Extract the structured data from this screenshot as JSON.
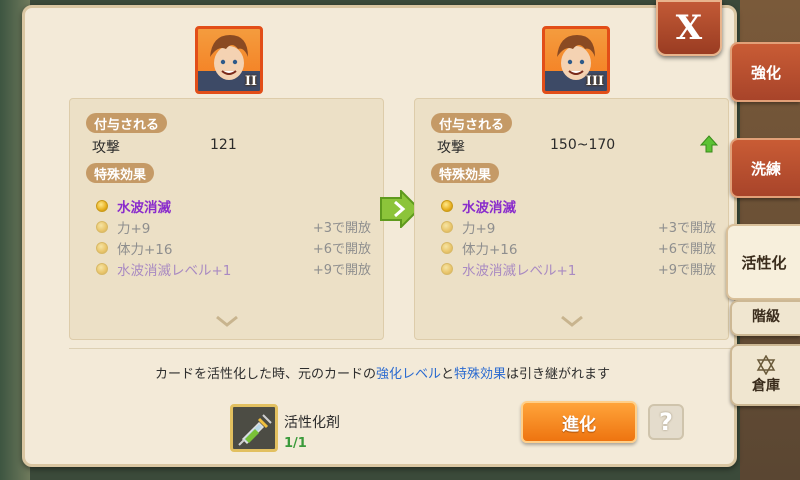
{
  "close_label": "X",
  "tabs": {
    "enhance": "強化",
    "refine": "洗練",
    "activate": "活性化",
    "rank": "階級",
    "storage": "倉庫"
  },
  "left_card": {
    "rank": "II",
    "granted_label": "付与される",
    "stat_label": "攻撃",
    "stat_value": "121",
    "special_label": "特殊効果",
    "effects": [
      {
        "name": "水波消滅",
        "condition": ""
      },
      {
        "name": "力+9",
        "condition": "+3で開放"
      },
      {
        "name": "体力+16",
        "condition": "+6で開放"
      },
      {
        "name": "水波消滅レベル+1",
        "condition": "+9で開放"
      }
    ]
  },
  "right_card": {
    "rank": "III",
    "granted_label": "付与される",
    "stat_label": "攻撃",
    "stat_value": "150~170",
    "special_label": "特殊効果",
    "effects": [
      {
        "name": "水波消滅",
        "condition": ""
      },
      {
        "name": "力+9",
        "condition": "+3で開放"
      },
      {
        "name": "体力+16",
        "condition": "+6で開放"
      },
      {
        "name": "水波消滅レベル+1",
        "condition": "+9で開放"
      }
    ]
  },
  "notice": {
    "prefix": "カードを活性化した時、元のカードの",
    "highlight1": "強化レベル",
    "mid": "と",
    "highlight2": "特殊効果",
    "suffix": "は引き継がれます"
  },
  "item": {
    "name": "活性化剤",
    "count": "1/1"
  },
  "evolve_label": "進化",
  "help_label": "?",
  "colors": {
    "accent_orange": "#ee7410",
    "tab_red": "#a8442a",
    "effect_purple": "#8a2ccc",
    "highlight_blue": "#2a6ad0",
    "count_green": "#3a9a3a"
  }
}
